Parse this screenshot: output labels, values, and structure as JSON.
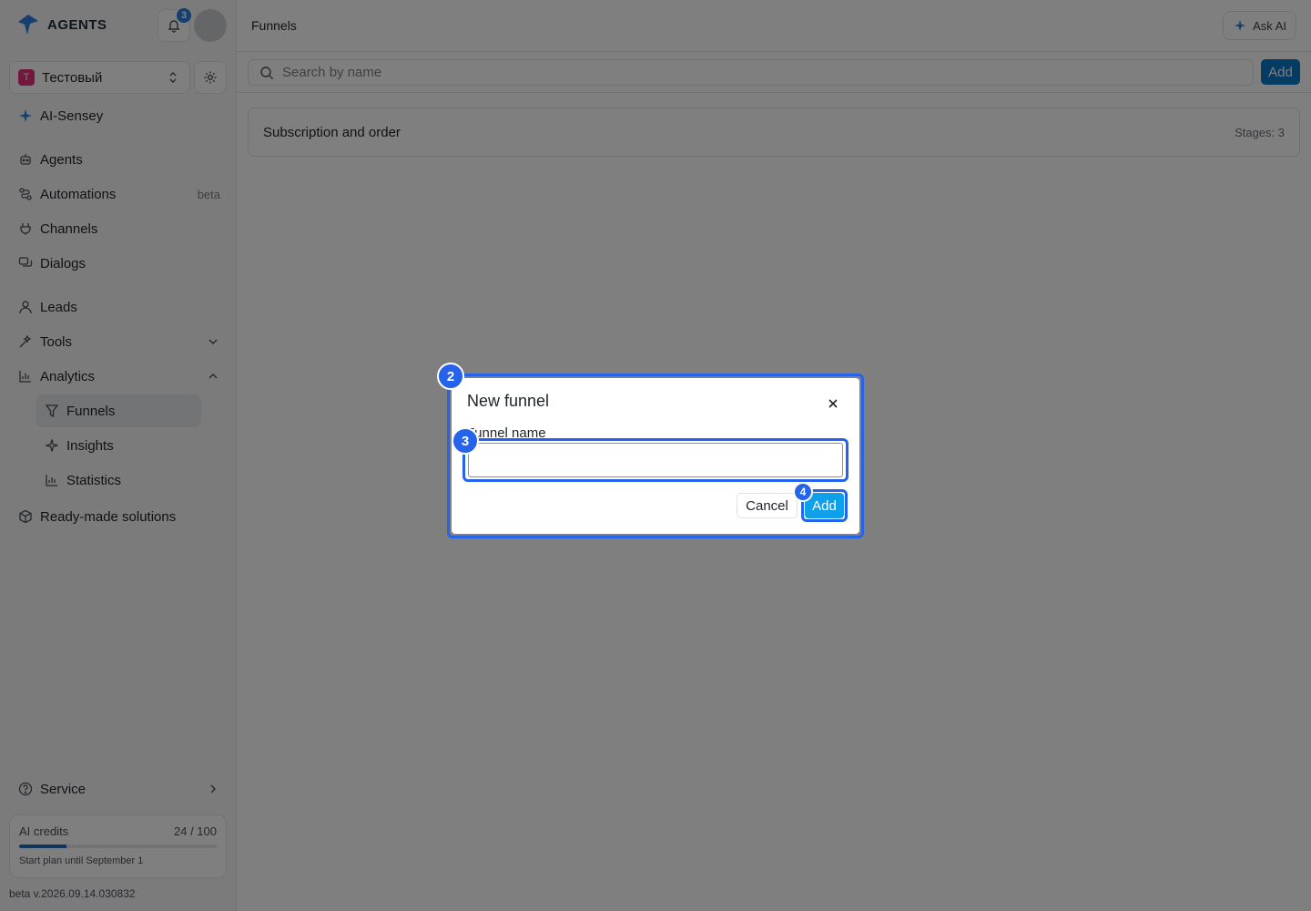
{
  "app": {
    "logo_text": "AGENTS",
    "notification_count": "3"
  },
  "workspace": {
    "initial": "Т",
    "name": "Тестовый"
  },
  "sidebar": {
    "ai_item": "AI-Sensey",
    "items": [
      {
        "label": "Agents",
        "icon": "agents-icon"
      },
      {
        "label": "Automations",
        "badge": "beta",
        "icon": "automations-icon"
      },
      {
        "label": "Channels",
        "icon": "channels-icon"
      },
      {
        "label": "Dialogs",
        "icon": "dialogs-icon"
      },
      {
        "label": "Leads",
        "icon": "leads-icon"
      },
      {
        "label": "Tools",
        "icon": "tools-icon"
      },
      {
        "label": "Analytics",
        "icon": "analytics-icon"
      }
    ],
    "analytics_sub": [
      {
        "label": "Funnels",
        "active": true
      },
      {
        "label": "Insights"
      },
      {
        "label": "Statistics"
      }
    ],
    "ready_made": "Ready-made solutions",
    "service": "Service",
    "credits": {
      "label": "AI credits",
      "value": "24 / 100",
      "fraction": 0.24,
      "plan": "Start plan until September 1"
    },
    "version": "beta v.2026.09.14.030832"
  },
  "header": {
    "title": "Funnels",
    "ask_ai": "Ask AI"
  },
  "toolbar": {
    "search_placeholder": "Search by name",
    "add_label": "Add"
  },
  "funnels": [
    {
      "name": "Subscription and order",
      "stages": "Stages: 3"
    }
  ],
  "modal": {
    "title": "New funnel",
    "field_label": "Funnel name",
    "field_value": "",
    "cancel_label": "Cancel",
    "add_label": "Add"
  },
  "markers": {
    "m2": "2",
    "m3": "3",
    "m4": "4"
  },
  "colors": {
    "accent": "#0b78c6",
    "highlight": "#2563eb",
    "workspace_badge": "#e5317c"
  }
}
